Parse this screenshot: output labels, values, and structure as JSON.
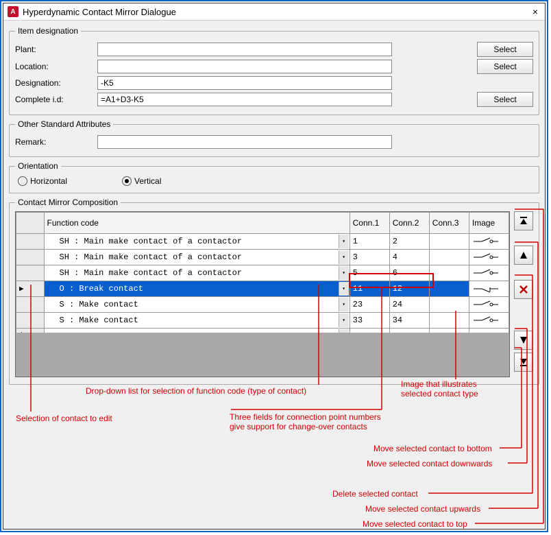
{
  "window": {
    "title": "Hyperdynamic Contact Mirror Dialogue",
    "app_letter": "A",
    "close": "×"
  },
  "designation": {
    "legend": "Item designation",
    "plant_label": "Plant:",
    "plant_value": "",
    "location_label": "Location:",
    "location_value": "",
    "designation_label": "Designation:",
    "designation_value": "-K5",
    "complete_label": "Complete i.d:",
    "complete_value": "=A1+D3-K5",
    "select_btn": "Select"
  },
  "other": {
    "legend": "Other Standard Attributes",
    "remark_label": "Remark:",
    "remark_value": ""
  },
  "orientation": {
    "legend": "Orientation",
    "horizontal": "Horizontal",
    "vertical": "Vertical",
    "selected": "vertical"
  },
  "composition": {
    "legend": "Contact Mirror Composition",
    "headers": {
      "func": "Function code",
      "c1": "Conn.1",
      "c2": "Conn.2",
      "c3": "Conn.3",
      "img": "Image"
    },
    "rows": [
      {
        "func": "SH : Main make contact of a contactor",
        "c1": "1",
        "c2": "2",
        "c3": "",
        "sym": "make",
        "selected": false
      },
      {
        "func": "SH : Main make contact of a contactor",
        "c1": "3",
        "c2": "4",
        "c3": "",
        "sym": "make",
        "selected": false
      },
      {
        "func": "SH : Main make contact of a contactor",
        "c1": "5",
        "c2": "6",
        "c3": "",
        "sym": "make",
        "selected": false
      },
      {
        "func": "O : Break contact",
        "c1": "11",
        "c2": "12",
        "c3": "",
        "sym": "break",
        "selected": true
      },
      {
        "func": "S : Make contact",
        "c1": "23",
        "c2": "24",
        "c3": "",
        "sym": "make",
        "selected": false
      },
      {
        "func": "S : Make contact",
        "c1": "33",
        "c2": "34",
        "c3": "",
        "sym": "make",
        "selected": false
      }
    ],
    "new_row_star": "*"
  },
  "side_icons": {
    "top": "move-top",
    "up": "move-up",
    "delete": "delete",
    "down": "move-down",
    "bottom": "move-bottom"
  },
  "annotations": {
    "dropdown": "Drop-down list for selection of function code (type of contact)",
    "img_illus": "Image that illustrates\nselected contact type",
    "sel_edit": "Selection of contact to edit",
    "three_fields": "Three fields for connection point numbers\ngive support for change-over contacts",
    "move_bottom": "Move selected contact to bottom",
    "move_down": "Move selected contact downwards",
    "delete": "Delete selected contact",
    "move_up": "Move selected contact upwards",
    "move_top": "Move selected contact to top"
  }
}
